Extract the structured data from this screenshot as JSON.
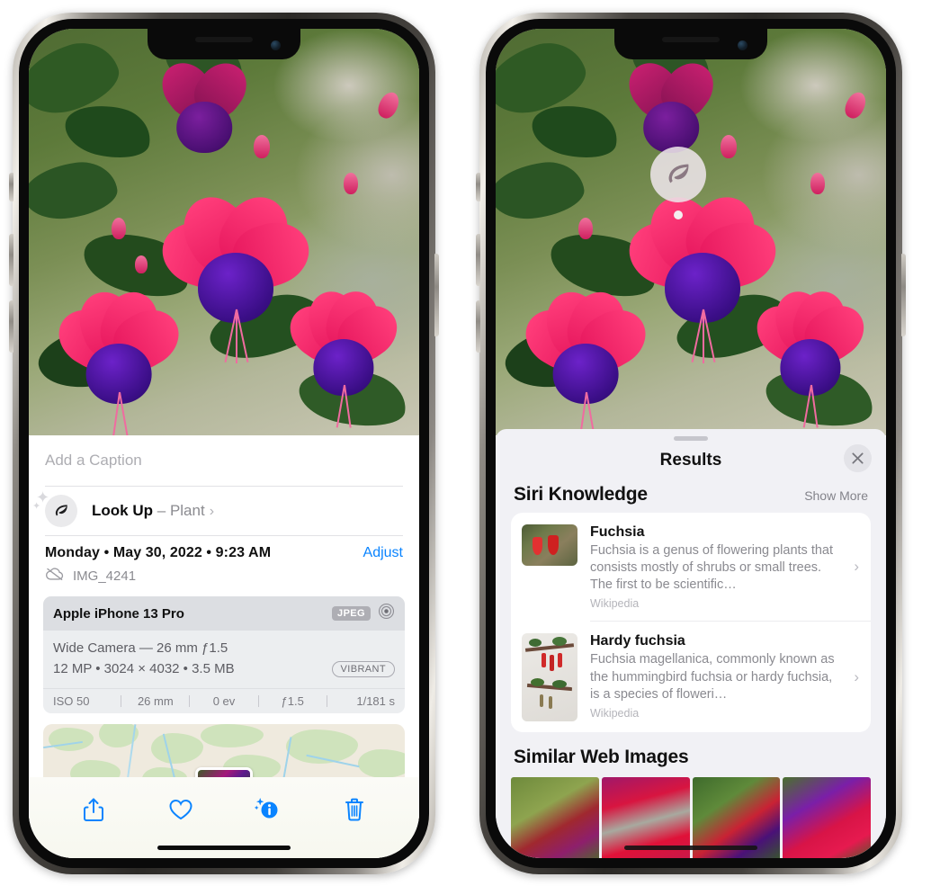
{
  "left_phone": {
    "caption_field": {
      "placeholder": "Add a Caption",
      "value": ""
    },
    "lookup_row": {
      "icon": "leaf-icon",
      "sparkle_icon": "sparkle-icon",
      "label": "Look Up",
      "dash": "–",
      "subject": "Plant",
      "chevron": "›"
    },
    "metadata": {
      "date": "Monday • May 30, 2022 • 9:23 AM",
      "adjust_label": "Adjust",
      "cloud_icon": "cloud-slash-icon",
      "filename": "IMG_4241"
    },
    "exif": {
      "device": "Apple iPhone 13 Pro",
      "format_badge": "JPEG",
      "lens_icon": "aperture-icon",
      "lens_line": "Wide Camera — 26 mm ƒ1.5",
      "size_line": "12 MP • 3024 × 4032 • 3.5 MB",
      "vibrant_badge": "VIBRANT",
      "stats": [
        "ISO 50",
        "26 mm",
        "0 ev",
        "ƒ1.5",
        "1/181 s"
      ]
    },
    "map": {
      "pin_label": "photo-pin"
    },
    "toolbar": [
      {
        "name": "share-button",
        "icon": "share-icon"
      },
      {
        "name": "favorite-button",
        "icon": "heart-icon"
      },
      {
        "name": "info-button",
        "icon": "info-sparkle-icon"
      },
      {
        "name": "delete-button",
        "icon": "trash-icon"
      }
    ],
    "accent_color": "#0a84ff"
  },
  "right_phone": {
    "visual_lookup_badge": {
      "icon": "leaf-icon"
    },
    "sheet": {
      "title": "Results",
      "close_icon": "close-icon",
      "sections": [
        {
          "title": "Siri Knowledge",
          "action_label": "Show More",
          "items": [
            {
              "title": "Fuchsia",
              "description": "Fuchsia is a genus of flowering plants that consists mostly of shrubs or small trees. The first to be scientific…",
              "source": "Wikipedia",
              "chevron": "›"
            },
            {
              "title": "Hardy fuchsia",
              "description": "Fuchsia magellanica, commonly known as the hummingbird fuchsia or hardy fuchsia, is a species of floweri…",
              "source": "Wikipedia",
              "chevron": "›"
            }
          ]
        },
        {
          "title": "Similar Web Images",
          "images": [
            "web-image-1",
            "web-image-2",
            "web-image-3",
            "web-image-4"
          ]
        }
      ]
    }
  }
}
